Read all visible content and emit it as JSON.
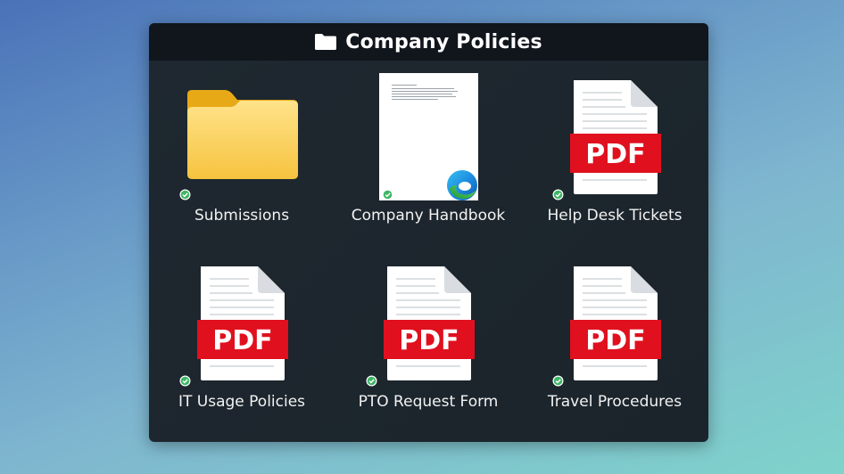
{
  "window": {
    "title": "Company Policies"
  },
  "colors": {
    "pdf_red": "#e0101e",
    "folder_yellow": "#f6c33f",
    "check_green": "#3fb566"
  },
  "items": [
    {
      "label": "Submissions",
      "type": "folder-icon",
      "synced": true
    },
    {
      "label": "Company Handbook",
      "type": "document-thumbnail",
      "synced": true
    },
    {
      "label": "Help Desk Tickets",
      "type": "pdf-icon",
      "badge": "PDF",
      "synced": true
    },
    {
      "label": "IT Usage Policies",
      "type": "pdf-icon",
      "badge": "PDF",
      "synced": true
    },
    {
      "label": "PTO Request Form",
      "type": "pdf-icon",
      "badge": "PDF",
      "synced": true
    },
    {
      "label": "Travel Procedures",
      "type": "pdf-icon",
      "badge": "PDF",
      "synced": true
    }
  ]
}
